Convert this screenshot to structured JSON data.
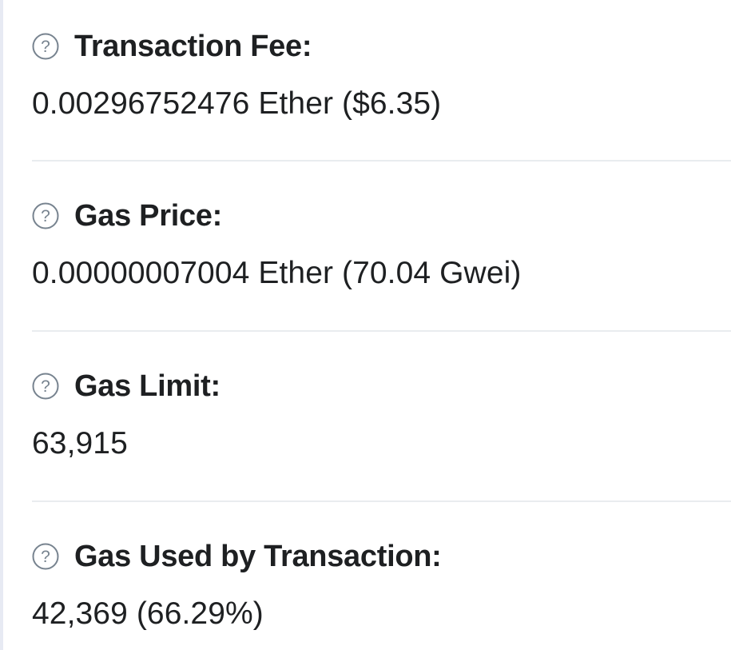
{
  "rows": [
    {
      "label": "Transaction Fee:",
      "value": "0.00296752476 Ether ($6.35)",
      "icon": "question-circle-icon"
    },
    {
      "label": "Gas Price:",
      "value": "0.00000007004 Ether (70.04 Gwei)",
      "icon": "question-circle-icon"
    },
    {
      "label": "Gas Limit:",
      "value": "63,915",
      "icon": "question-circle-icon"
    },
    {
      "label": "Gas Used by Transaction:",
      "value": "42,369 (66.29%)",
      "icon": "question-circle-icon"
    }
  ],
  "colors": {
    "text": "#1e2022",
    "icon": "#77838f",
    "divider": "#e9ecef",
    "left_border": "#e7eaf3"
  }
}
